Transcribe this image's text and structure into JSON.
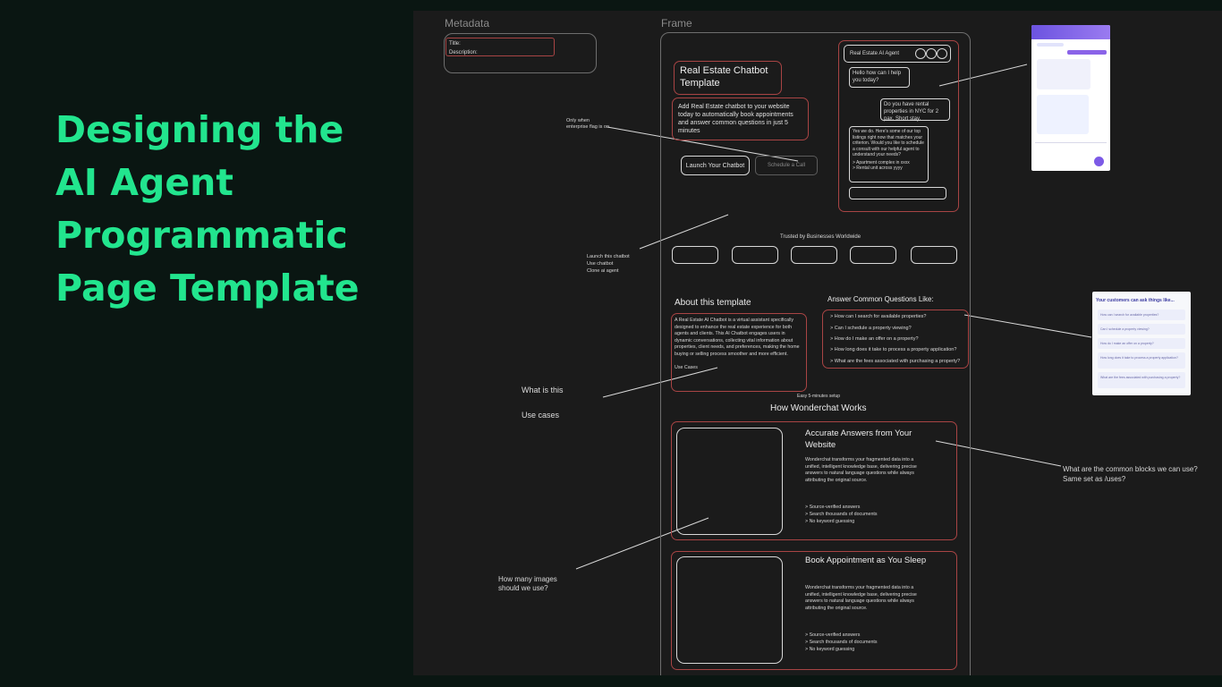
{
  "title": "Designing the AI Agent Programmatic Page Template",
  "canvas": {
    "metadata_label": "Metadata",
    "metadata_fields": [
      "Title:",
      "Description:"
    ],
    "frame_label": "Frame"
  },
  "hero": {
    "title": "Real Estate Chatbot Template",
    "description": "Add Real Estate chatbot to your website today to automatically book appointments and answer common questions in just 5 minutes",
    "primary_button": "Launch Your Chatbot",
    "secondary_button": "Schedule a Call"
  },
  "chat": {
    "header": "Real Estate AI Agent",
    "bot_greeting": "Hello how can I help you today?",
    "user_message": "Do you have rental properties in NYC for 2 pax. Short stay.",
    "bot_reply": "Yes we do. Here's some of our top listings right now that matches your criterion. Would you like to schedule a consult with our helpful agent to understand your needs?",
    "options": [
      "> Apartment complex in xxxx",
      "> Rental unit across yyyy"
    ]
  },
  "trusted": {
    "label": "Trusted by Businesses Worldwide"
  },
  "about": {
    "heading": "About this template",
    "body": "A Real Estate AI Chatbot is a virtual assistant specifically designed to enhance the real estate experience for both agents and clients. This AI Chatbot engages users in dynamic conversations, collecting vital information about properties, client needs, and preferences, making the home buying or selling process smoother and more efficient.",
    "use_cases": "Use Cases"
  },
  "questions": {
    "heading": "Answer Common Questions Like:",
    "items": [
      "> How can I search for available properties?",
      "> Can I schedule a property viewing?",
      "> How do I make an offer on a property?",
      "> How long does it take to process a property application?",
      "> What are the fees associated with purchasing a property?"
    ]
  },
  "how_it_works": {
    "setup": "Easy 5-minutes setup",
    "heading": "How Wonderchat Works",
    "features": [
      {
        "title": "Accurate Answers from Your Website",
        "body": "Wonderchat transforms your fragmented data into a unified, intelligent knowledge base, delivering precise answers to natural language questions while always attributing the original source.",
        "bullets": [
          "> Source-verified answers",
          "> Search thousands of documents",
          "> No keyword guessing"
        ]
      },
      {
        "title": "Book Appointment as You Sleep",
        "body": "Wonderchat transforms your fragmented data into a unified, intelligent knowledge base, delivering precise answers to natural language questions while always attributing the original source.",
        "bullets": [
          "> Source-verified answers",
          "> Search thousands of documents",
          "> No keyword guessing"
        ]
      }
    ]
  },
  "annotations": {
    "enterprise_flag": "Only when enterprise flag is on",
    "launch_notes": "Launch this chatbot\nUse chatbot\nClone ai agent",
    "what_is_this": "What is this",
    "use_cases": "Use cases",
    "common_blocks": "What are the common blocks we can use?\nSame set as /uses?",
    "how_many_images": "How many images\nshould we use?"
  },
  "reference_questions": {
    "title": "Your customers can ask things like...",
    "items": [
      "How can I search for available properties?",
      "Can I schedule a property viewing?",
      "How do I make an offer on a property?",
      "How long does it take to process a property application?",
      "What are the fees associated with purchasing a property?"
    ]
  },
  "colors": {
    "title_green": "#22e58e",
    "canvas": "#1b1b1b",
    "background": "#0a1612",
    "red_outline": "#a84444",
    "chat_purple": "#8a63e8"
  }
}
